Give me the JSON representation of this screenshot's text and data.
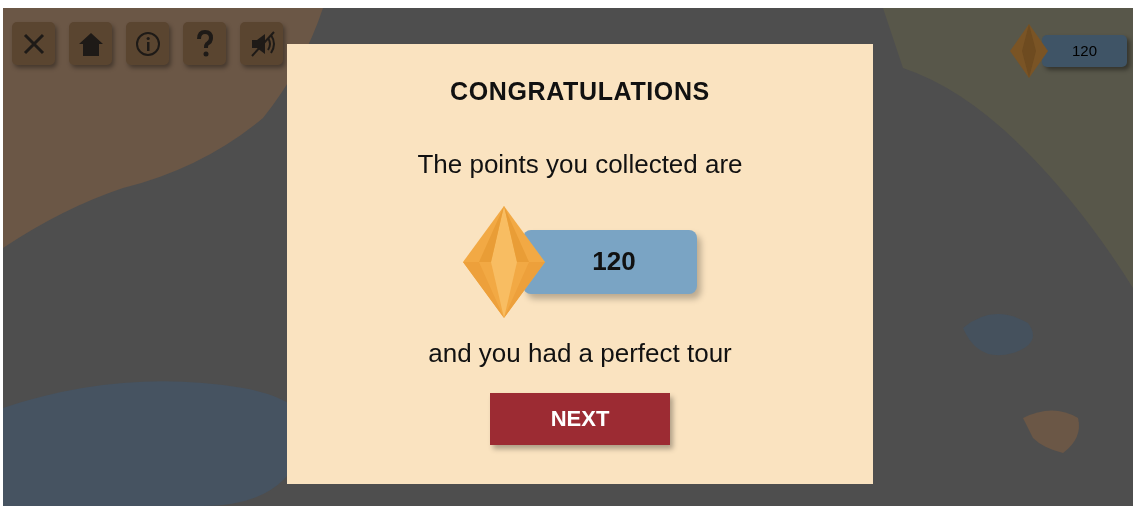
{
  "toolbar": {
    "buttons": [
      {
        "kind": "close"
      },
      {
        "kind": "home"
      },
      {
        "kind": "info"
      },
      {
        "kind": "help"
      },
      {
        "kind": "sound"
      }
    ]
  },
  "points_counter": {
    "value": "120"
  },
  "dialog": {
    "title": "CONGRATULATIONS",
    "message": "The points you collected are",
    "points": "120",
    "result": "and you had a perfect tour",
    "button": "NEXT"
  }
}
